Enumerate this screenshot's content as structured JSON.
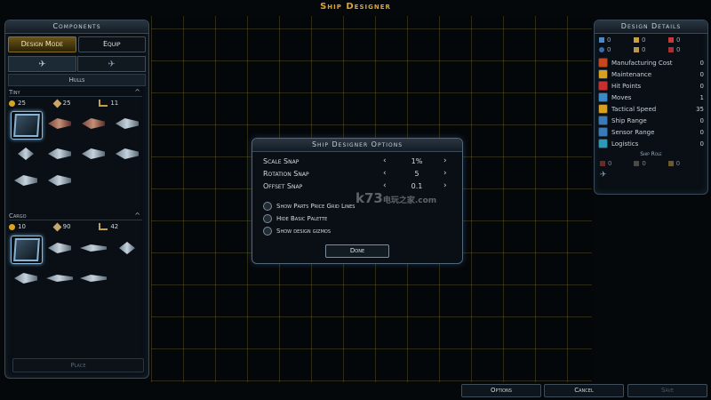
{
  "title": "Ship Designer",
  "left_panel": {
    "header": "Components",
    "modes": [
      "Design Mode",
      "Equip"
    ],
    "sub_header": "Hulls",
    "tiny": {
      "label": "Tiny",
      "stats": [
        "25",
        "25",
        "11"
      ]
    },
    "cargo": {
      "label": "Cargo",
      "stats": [
        "10",
        "90",
        "42"
      ]
    },
    "place_label": "Place"
  },
  "right_panel": {
    "header": "Design Details",
    "top_values": [
      "0",
      "0",
      "0",
      "0",
      "0",
      "0"
    ],
    "rows": [
      {
        "label": "Manufacturing Cost",
        "value": "0",
        "color": "#c8461e"
      },
      {
        "label": "Maintenance",
        "value": "0",
        "color": "#d8a020"
      },
      {
        "label": "Hit Points",
        "value": "0",
        "color": "#c83030"
      },
      {
        "label": "Moves",
        "value": "1",
        "color": "#3a8ac8"
      },
      {
        "label": "Tactical Speed",
        "value": "35",
        "color": "#d8a020"
      },
      {
        "label": "Ship Range",
        "value": "0",
        "color": "#3a7ab8"
      },
      {
        "label": "Sensor Range",
        "value": "0",
        "color": "#3a7ab8"
      },
      {
        "label": "Logistics",
        "value": "0",
        "color": "#2a9ab8"
      }
    ],
    "role_label": "Ship Role",
    "role_values": [
      "0",
      "0",
      "0"
    ]
  },
  "dialog": {
    "title": "Ship Designer Options",
    "options": [
      {
        "label": "Scale Snap",
        "value": "1%"
      },
      {
        "label": "Rotation Snap",
        "value": "5"
      },
      {
        "label": "Offset Snap",
        "value": "0.1"
      }
    ],
    "checks": [
      "Show Parts Price Grid Lines",
      "Hide Basic Palette",
      "Show design gizmos"
    ],
    "done_label": "Done"
  },
  "watermark": {
    "main": "k73",
    "sub": "电玩之家",
    "domain": ".com"
  },
  "bottom_buttons": {
    "options": "Options",
    "cancel": "Cancel",
    "save": "Save"
  }
}
